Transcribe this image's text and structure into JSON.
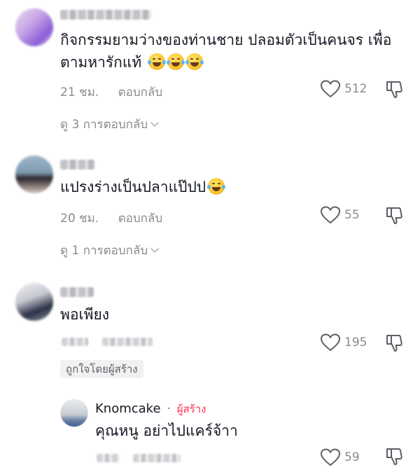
{
  "comments": [
    {
      "text_line1": "กิจกรรมยามว่างของท่านชาย ปลอมตัวเป็นคนจร เพื่อ",
      "text_line2": "ตามหารักแท้",
      "time": "21 ชม.",
      "reply_label": "ตอบกลับ",
      "likes": "512",
      "view_replies": "ดู 3 การตอบกลับ",
      "emoji_count": 3
    },
    {
      "text_line1": "แปรงร่างเป็นปลาแป๊ปป",
      "time": "20 ชม.",
      "reply_label": "ตอบกลับ",
      "likes": "55",
      "view_replies": "ดู 1 การตอบกลับ",
      "emoji_count": 1
    },
    {
      "text_line1": "พอเพียง",
      "likes": "195",
      "liked_by_creator": "ถูกใจโดยผู้สร้าง"
    }
  ],
  "reply": {
    "username": "Knomcake",
    "separator": "·",
    "creator_label": "ผู้สร้าง",
    "text": "คุณหนู อย่าไปแคร์จ้าา",
    "likes": "59"
  },
  "icons": {
    "like": "heart-outline-icon",
    "dislike": "thumbs-down-outline-icon",
    "expand": "chevron-down-icon",
    "emoji": "face-with-tears-of-joy-emoji"
  },
  "colors": {
    "text": "#161823",
    "secondary": "#8a8b91",
    "creator_accent": "#fe2c55"
  }
}
